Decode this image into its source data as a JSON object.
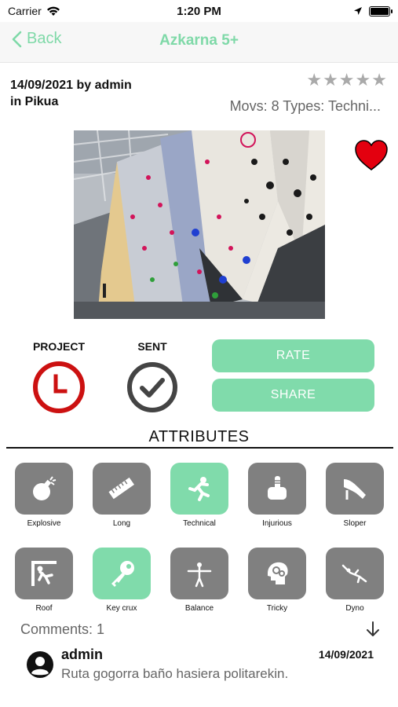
{
  "status_bar": {
    "carrier": "Carrier",
    "time": "1:20 PM",
    "icons": [
      "wifi-icon",
      "location-arrow-icon",
      "battery-icon"
    ]
  },
  "nav": {
    "back_label": "Back",
    "title": "Azkarna 5+",
    "accent_color": "#7fd9a8"
  },
  "route": {
    "date_author": "14/09/2021 by admin",
    "location": "in Pikua",
    "rating_stars": 5,
    "rating_filled": 0,
    "movs_types": "Movs: 8 Types: Techni...",
    "favorite": true
  },
  "photo": {
    "description_icon": "climbing-wall-photo"
  },
  "status": {
    "project_label": "PROJECT",
    "sent_label": "SENT",
    "project_color": "#cc1111",
    "sent_color": "#444444"
  },
  "actions": {
    "rate_label": "RATE",
    "share_label": "SHARE",
    "button_color": "#80dbab"
  },
  "attributes": {
    "title": "ATTRIBUTES",
    "items": [
      {
        "label": "Explosive",
        "icon": "bomb-icon",
        "active": false
      },
      {
        "label": "Long",
        "icon": "ruler-icon",
        "active": false
      },
      {
        "label": "Technical",
        "icon": "technical-climber-icon",
        "active": true
      },
      {
        "label": "Injurious",
        "icon": "injured-finger-icon",
        "active": false
      },
      {
        "label": "Sloper",
        "icon": "sloper-hand-icon",
        "active": false
      },
      {
        "label": "Roof",
        "icon": "roof-climber-icon",
        "active": false
      },
      {
        "label": "Key crux",
        "icon": "key-icon",
        "active": true
      },
      {
        "label": "Balance",
        "icon": "balance-icon",
        "active": false
      },
      {
        "label": "Tricky",
        "icon": "brain-gears-icon",
        "active": false
      },
      {
        "label": "Dyno",
        "icon": "dyno-jump-icon",
        "active": false
      }
    ]
  },
  "comments": {
    "header": "Comments: 1",
    "items": [
      {
        "author": "admin",
        "date": "14/09/2021",
        "text": "Ruta gogorra baño hasiera politarekin."
      }
    ]
  }
}
